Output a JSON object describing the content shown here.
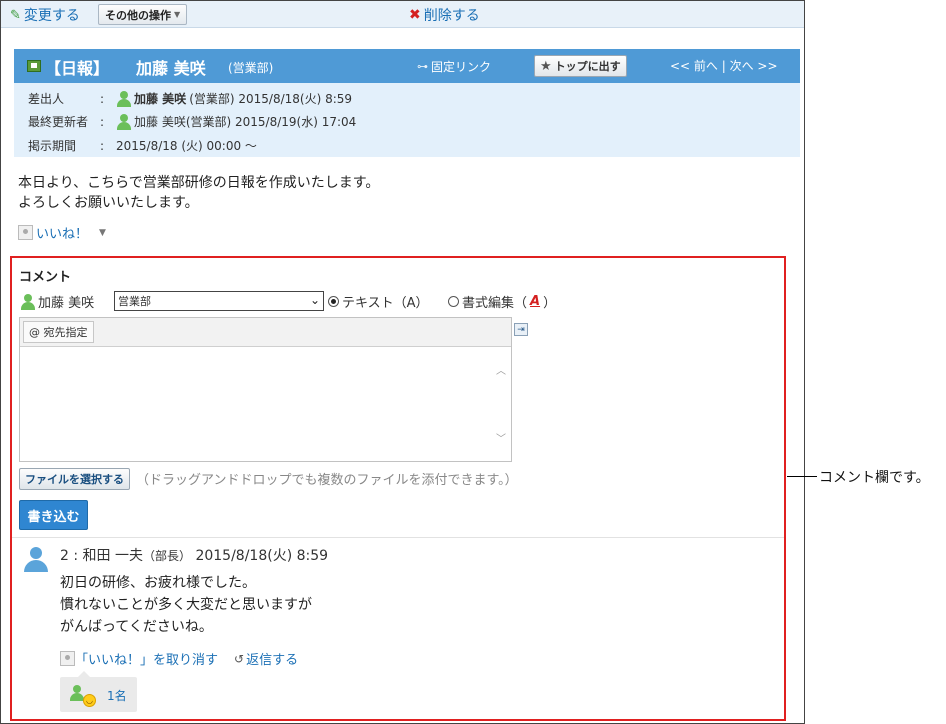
{
  "toolbar": {
    "edit_label": "変更する",
    "other_ops_label": "その他の操作",
    "delete_label": "削除する"
  },
  "title": {
    "kind": "【日報】",
    "name": "加藤 美咲",
    "dept": "(営業部)",
    "permalink_label": "固定リンク",
    "top_button_label": "トップに出す",
    "prev_next": "<< 前へ | 次へ >>"
  },
  "meta": {
    "sender_label": "差出人",
    "sender_name": "加藤 美咲",
    "sender_rest": "(営業部) 2015/8/18(火) 8:59",
    "updater_label": "最終更新者",
    "updater_value": "加藤 美咲(営業部) 2015/8/19(水) 17:04",
    "period_label": "掲示期間",
    "period_value": "2015/8/18 (火) 00:00 〜",
    "colon": ":"
  },
  "body": {
    "line1": "本日より、こちらで営業部研修の日報を作成いたします。",
    "line2": "よろしくお願いいたします。",
    "like_label": "いいね！"
  },
  "comment_form": {
    "heading": "コメント",
    "author": "加藤 美咲",
    "dept_selected": "営業部",
    "radio_text": "テキスト（A）",
    "radio_rich_prefix": "書式編集（",
    "radio_rich_a": "A",
    "radio_rich_suffix": "）",
    "mention_label": "@ 宛先指定",
    "file_button": "ファイルを選択する",
    "file_hint": "（ドラッグアンドドロップでも複数のファイルを添付できます。）",
    "submit": "書き込む"
  },
  "comment": {
    "number_name": "2 : 和田 一夫",
    "role": "（部長）",
    "datetime": "2015/8/18(火) 8:59",
    "line1": "初日の研修、お疲れ様でした。",
    "line2": "慣れないことが多く大変だと思いますが",
    "line3": "がんばってくださいね。",
    "unlike_label": "「いいね！」を取り消す",
    "reply_label": "返信する",
    "like_count": "1名"
  },
  "callout": {
    "text": "コメント欄です。"
  },
  "colors": {
    "title_bar": "#4f9ad6",
    "meta_bg": "#e3f0fb",
    "link": "#1a6fb5",
    "highlight_border": "#e02020",
    "submit_button": "#2f86d1"
  }
}
